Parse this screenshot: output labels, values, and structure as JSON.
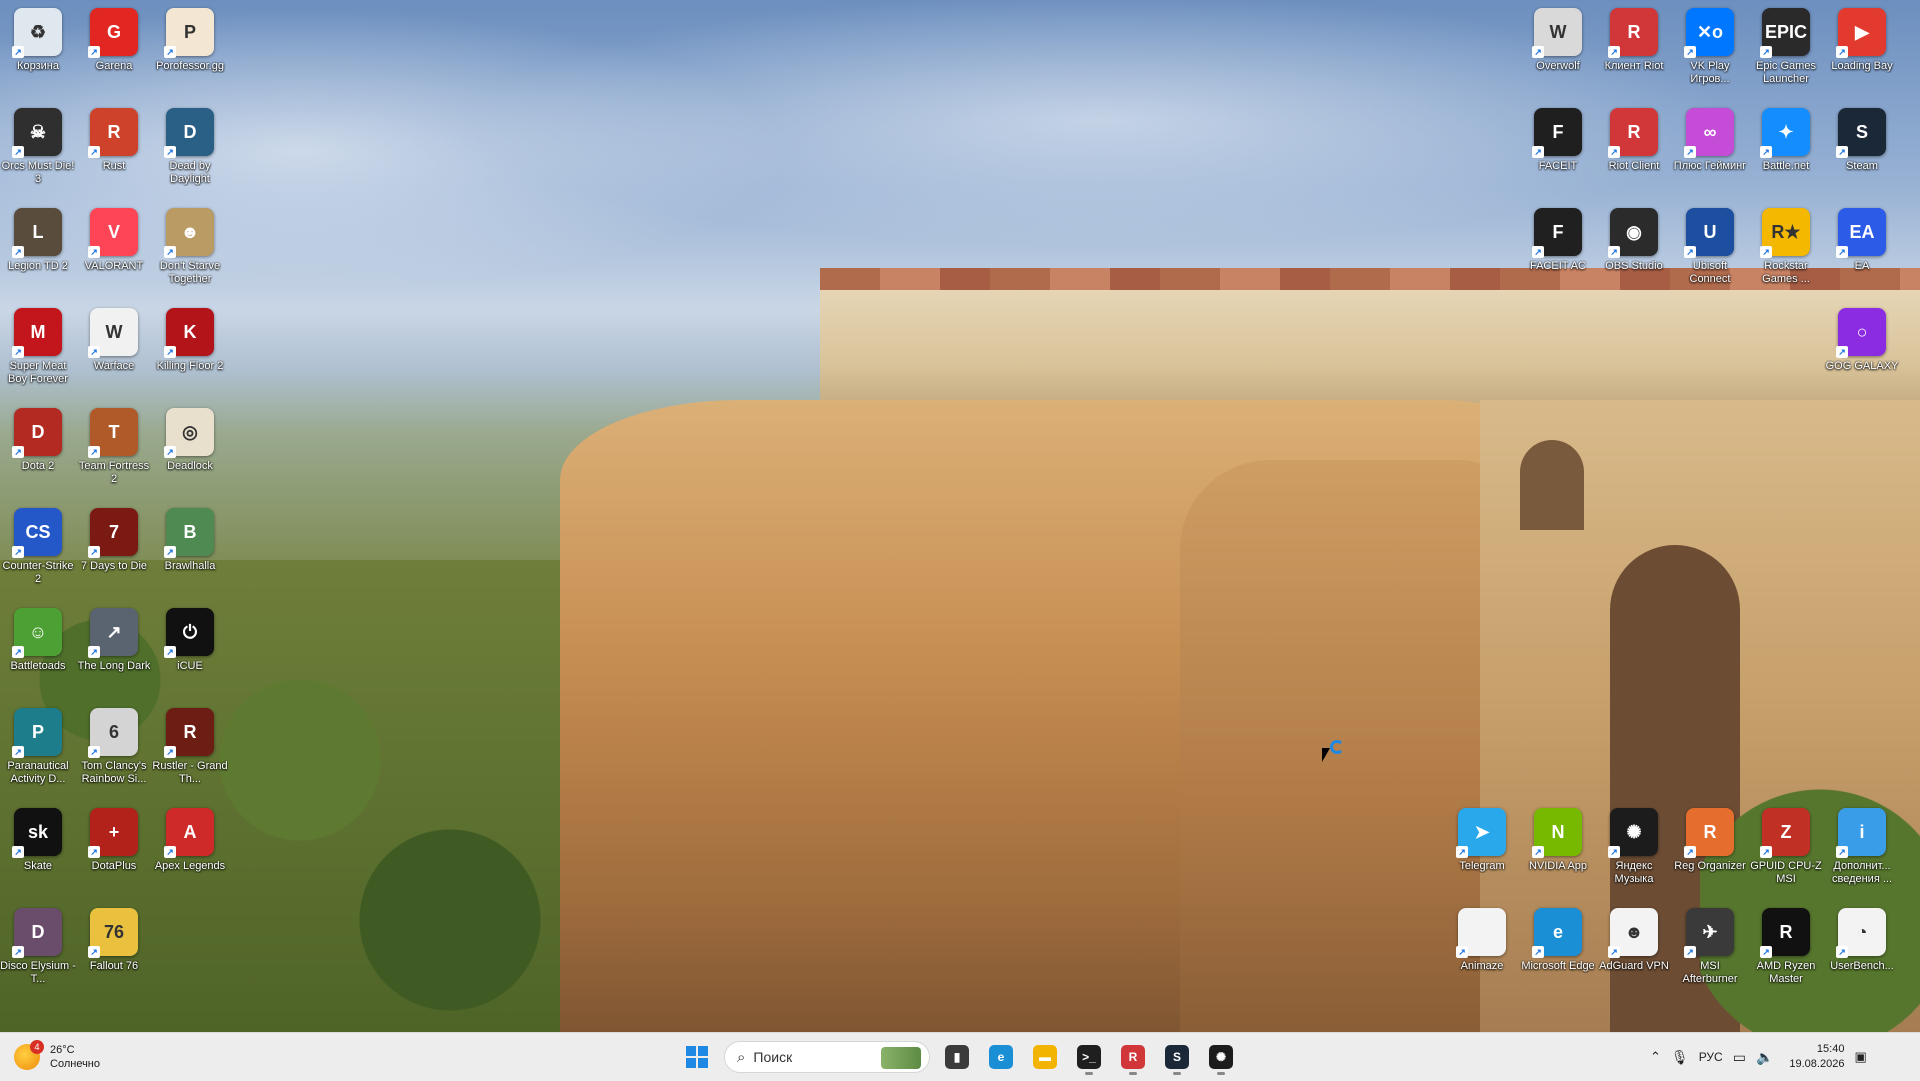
{
  "desktop": {
    "icons_left": [
      {
        "label": "Корзина",
        "icon": "recycle-bin-icon",
        "color": "#dfe8ef",
        "glyph": "♻"
      },
      {
        "label": "Garena",
        "icon": "garena-icon",
        "color": "#e22622",
        "glyph": "G"
      },
      {
        "label": "Porofessor.gg",
        "icon": "porofessor-icon",
        "color": "#f3e7d3",
        "glyph": "P"
      },
      {
        "label": "Orcs Must Die! 3",
        "icon": "orcs-must-die-icon",
        "color": "#2f2f2f",
        "glyph": "☠"
      },
      {
        "label": "Rust",
        "icon": "rust-icon",
        "color": "#ce422b",
        "glyph": "R"
      },
      {
        "label": "Dead by Daylight",
        "icon": "dead-by-daylight-icon",
        "color": "#2a5f86",
        "glyph": "D"
      },
      {
        "label": "Legion TD 2",
        "icon": "legion-td-icon",
        "color": "#5a4c3c",
        "glyph": "L"
      },
      {
        "label": "VALORANT",
        "icon": "valorant-icon",
        "color": "#fd4556",
        "glyph": "V"
      },
      {
        "label": "Don't Starve Together",
        "icon": "dont-starve-icon",
        "color": "#b99b63",
        "glyph": "☻"
      },
      {
        "label": "Super Meat Boy Forever",
        "icon": "super-meat-boy-icon",
        "color": "#c3161c",
        "glyph": "M"
      },
      {
        "label": "Warface",
        "icon": "warface-icon",
        "color": "#f1f1f1",
        "glyph": "W"
      },
      {
        "label": "Killing Floor 2",
        "icon": "killing-floor-icon",
        "color": "#b3141a",
        "glyph": "K"
      },
      {
        "label": "Dota 2",
        "icon": "dota-icon",
        "color": "#b22a22",
        "glyph": "D"
      },
      {
        "label": "Team Fortress 2",
        "icon": "team-fortress-icon",
        "color": "#b05a2a",
        "glyph": "T"
      },
      {
        "label": "Deadlock",
        "icon": "deadlock-icon",
        "color": "#e8e0cc",
        "glyph": "◎"
      },
      {
        "label": "Counter-Strike 2",
        "icon": "counter-strike-icon",
        "color": "#2458c8",
        "glyph": "CS"
      },
      {
        "label": "7 Days to Die",
        "icon": "seven-days-icon",
        "color": "#7a1a12",
        "glyph": "7"
      },
      {
        "label": "Brawlhalla",
        "icon": "brawlhalla-icon",
        "color": "#4e8a52",
        "glyph": "B"
      },
      {
        "label": "Battletoads",
        "icon": "battletoads-icon",
        "color": "#4da033",
        "glyph": "☺"
      },
      {
        "label": "The Long Dark",
        "icon": "the-long-dark-icon",
        "color": "#5a6470",
        "glyph": "↗"
      },
      {
        "label": "iCUE",
        "icon": "icue-icon",
        "color": "#111111",
        "glyph": "⏻"
      },
      {
        "label": "Paranautical Activity D...",
        "icon": "paranautical-icon",
        "color": "#1e7d8a",
        "glyph": "P"
      },
      {
        "label": "Tom Clancy's Rainbow Si...",
        "icon": "rainbow-six-icon",
        "color": "#d4d4d4",
        "glyph": "6"
      },
      {
        "label": "Rustler - Grand Th...",
        "icon": "rustler-icon",
        "color": "#6c1d14",
        "glyph": "R"
      },
      {
        "label": "Skate",
        "icon": "skate-icon",
        "color": "#111111",
        "glyph": "sk"
      },
      {
        "label": "DotaPlus",
        "icon": "dotaplus-icon",
        "color": "#b2221a",
        "glyph": "+"
      },
      {
        "label": "Apex Legends",
        "icon": "apex-icon",
        "color": "#cf2a2a",
        "glyph": "A"
      },
      {
        "label": "Disco Elysium - T...",
        "icon": "disco-elysium-icon",
        "color": "#6a4d6a",
        "glyph": "D"
      },
      {
        "label": "Fallout 76",
        "icon": "fallout-icon",
        "color": "#e9c13f",
        "glyph": "76"
      }
    ],
    "icons_right": [
      {
        "label": "Overwolf",
        "icon": "overwolf-icon",
        "color": "#d9d9d9",
        "glyph": "W"
      },
      {
        "label": "Клиент Riot",
        "icon": "riot-client-icon",
        "color": "#d13639",
        "glyph": "R"
      },
      {
        "label": "VK Play Игров...",
        "icon": "vk-play-icon",
        "color": "#0077ff",
        "glyph": "✕o"
      },
      {
        "label": "Epic Games Launcher",
        "icon": "epic-games-icon",
        "color": "#2a2a2a",
        "glyph": "EPIC"
      },
      {
        "label": "Loading Bay",
        "icon": "loading-bay-icon",
        "color": "#e23a2f",
        "glyph": "▶"
      },
      {
        "label": "FACEIT",
        "icon": "faceit-icon",
        "color": "#1f1f1f",
        "glyph": "F"
      },
      {
        "label": "Riot Client",
        "icon": "riot-client-2-icon",
        "color": "#d13639",
        "glyph": "R"
      },
      {
        "label": "Плюс Гейминг",
        "icon": "plus-gaming-icon",
        "color": "#c44cd6",
        "glyph": "∞"
      },
      {
        "label": "Battle.net",
        "icon": "battlenet-icon",
        "color": "#148eff",
        "glyph": "✦"
      },
      {
        "label": "Steam",
        "icon": "steam-icon",
        "color": "#1b2838",
        "glyph": "S"
      },
      {
        "label": "FACEIT AC",
        "icon": "faceit-ac-icon",
        "color": "#202020",
        "glyph": "F"
      },
      {
        "label": "OBS Studio",
        "icon": "obs-studio-icon",
        "color": "#2b2b2b",
        "glyph": "◉"
      },
      {
        "label": "Ubisoft Connect",
        "icon": "ubisoft-icon",
        "color": "#1c4fa0",
        "glyph": "U"
      },
      {
        "label": "Rockstar Games ...",
        "icon": "rockstar-icon",
        "color": "#f5b800",
        "glyph": "R★"
      },
      {
        "label": "EA",
        "icon": "ea-icon",
        "color": "#2c5be8",
        "glyph": "EA"
      },
      {
        "label": "GOG GALAXY",
        "icon": "gog-galaxy-icon",
        "color": "#8b2be2",
        "glyph": "○"
      },
      {
        "label": "Telegram",
        "icon": "telegram-icon",
        "color": "#29a9eb",
        "glyph": "➤"
      },
      {
        "label": "NVIDIA App",
        "icon": "nvidia-icon",
        "color": "#76b900",
        "glyph": "N"
      },
      {
        "label": "Яндекс Музыка",
        "icon": "yandex-music-icon",
        "color": "#1c1c1c",
        "glyph": "✺"
      },
      {
        "label": "Reg Organizer",
        "icon": "reg-organizer-icon",
        "color": "#e56d2e",
        "glyph": "R"
      },
      {
        "label": "GPUID CPU-Z MSI",
        "icon": "cpuz-icon",
        "color": "#c03025",
        "glyph": "Z"
      },
      {
        "label": "Дополнит... сведения ...",
        "icon": "additional-info-icon",
        "color": "#3a9de8",
        "glyph": "i"
      },
      {
        "label": "Animaze",
        "icon": "animaze-icon",
        "color": "#f3f3f3",
        "glyph": ""
      },
      {
        "label": "Microsoft Edge",
        "icon": "edge-icon",
        "color": "#1b8fd6",
        "glyph": "e"
      },
      {
        "label": "AdGuard VPN",
        "icon": "adguard-icon",
        "color": "#f3f3f3",
        "glyph": "☻"
      },
      {
        "label": "MSI Afterburner",
        "icon": "msi-afterburner-icon",
        "color": "#3a3a3a",
        "glyph": "✈"
      },
      {
        "label": "AMD Ryzen Master",
        "icon": "ryzen-master-icon",
        "color": "#111111",
        "glyph": "R"
      },
      {
        "label": "UserBench...",
        "icon": "userbenchmark-icon",
        "color": "#f3f3f3",
        "glyph": "◔"
      }
    ]
  },
  "taskbar": {
    "weather": {
      "temp": "26°C",
      "condition": "Солнечно",
      "badge": "4"
    },
    "search": {
      "placeholder": "Поиск"
    },
    "apps": [
      {
        "name": "file-explorer-tb-icon",
        "color": "#3b3b3b",
        "glyph": "▮"
      },
      {
        "name": "edge-tb-icon",
        "color": "#1b8fd6",
        "glyph": "e"
      },
      {
        "name": "folder-tb-icon",
        "color": "#f2b400",
        "glyph": "▬"
      },
      {
        "name": "terminal-tb-icon",
        "color": "#1f1f1f",
        "glyph": ">_"
      },
      {
        "name": "riot-tb-icon",
        "color": "#d13639",
        "glyph": "R"
      },
      {
        "name": "steam-tb-icon",
        "color": "#1b2838",
        "glyph": "S"
      },
      {
        "name": "yandex-music-tb-icon",
        "color": "#1c1c1c",
        "glyph": "✺"
      }
    ],
    "tray": {
      "language": "РУС",
      "time": "15:40",
      "date": "19.08.2026"
    }
  }
}
